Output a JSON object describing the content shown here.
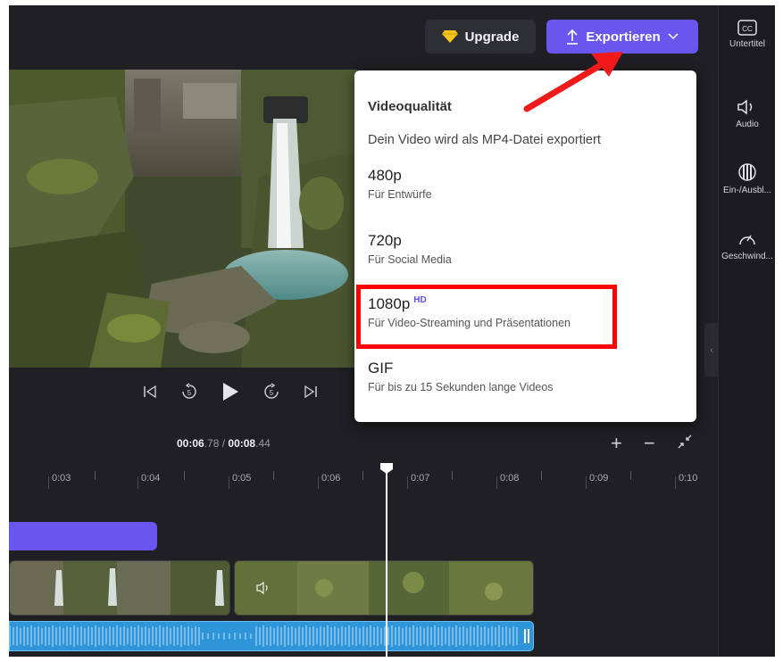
{
  "header": {
    "upgrade_label": "Upgrade",
    "export_label": "Exportieren"
  },
  "rail": {
    "items": [
      {
        "label": "Untertitel",
        "icon": "captions-icon"
      },
      {
        "label": "Audio",
        "icon": "speaker-icon"
      },
      {
        "label": "Ein-/Ausbl...",
        "icon": "fade-icon"
      },
      {
        "label": "Geschwind...",
        "icon": "speedometer-icon"
      }
    ]
  },
  "player": {
    "time_current_main": "00:06",
    "time_current_frac": ".78",
    "time_sep": " / ",
    "time_total_main": "00:08",
    "time_total_frac": ".44"
  },
  "timeline": {
    "ticks": [
      "0:03",
      "0:04",
      "0:05",
      "0:06",
      "0:07",
      "0:08",
      "0:09",
      "0:10"
    ]
  },
  "export_menu": {
    "title": "Videoqualität",
    "subtitle": "Dein Video wird als MP4-Datei exportiert",
    "options": [
      {
        "name": "480p",
        "desc": "Für Entwürfe"
      },
      {
        "name": "720p",
        "desc": "Für Social Media"
      },
      {
        "name": "1080p",
        "badge": "HD",
        "desc": "Für Video-Streaming und Präsentationen"
      },
      {
        "name": "GIF",
        "desc": "Für bis zu 15 Sekunden lange Videos"
      }
    ]
  },
  "colors": {
    "accent": "#6956ee",
    "highlight": "#ff0000",
    "audio": "#2e95d8",
    "background": "#1f1f24"
  }
}
